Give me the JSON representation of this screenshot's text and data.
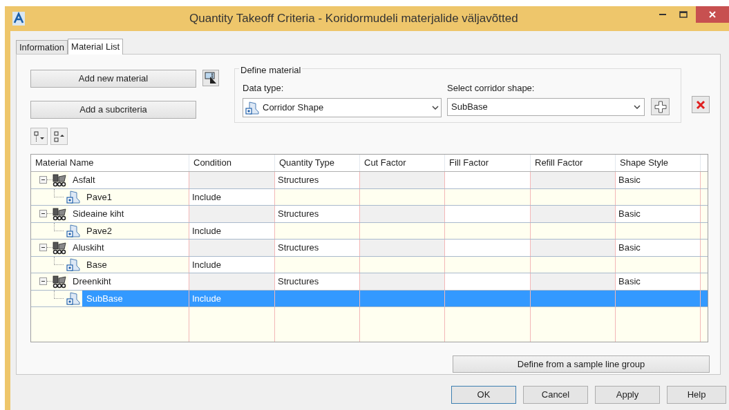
{
  "window": {
    "title": "Quantity Takeoff Criteria - Koridormudeli materjalide väljavõtted"
  },
  "tabs": [
    {
      "label": "Information",
      "selected": false
    },
    {
      "label": "Material List",
      "selected": true
    }
  ],
  "actions": [
    "Add new material",
    "Add a subcriteria"
  ],
  "define_material": {
    "title": "Define material",
    "data_type_label": "Data type:",
    "data_type": "Corridor Shape",
    "shape_label": "Select corridor shape:",
    "shape": "SubBase"
  },
  "table": {
    "columns": [
      "Material Name",
      "Condition",
      "Quantity Type",
      "Cut Factor",
      "Fill Factor",
      "Refill Factor",
      "Shape Style"
    ],
    "rows": [
      {
        "name": "Asfalt",
        "quantity_type": "Structures",
        "shape_style": "Basic",
        "expanded": true,
        "selected": false,
        "children": [
          {
            "name": "Pave1",
            "condition": "Include",
            "selected": false
          }
        ]
      },
      {
        "name": "Sideaine kiht",
        "quantity_type": "Structures",
        "shape_style": "Basic",
        "expanded": true,
        "selected": false,
        "children": [
          {
            "name": "Pave2",
            "condition": "Include",
            "selected": false
          }
        ]
      },
      {
        "name": "Aluskiht",
        "quantity_type": "Structures",
        "shape_style": "Basic",
        "expanded": true,
        "selected": false,
        "children": [
          {
            "name": "Base",
            "condition": "Include",
            "selected": false
          }
        ]
      },
      {
        "name": "Dreenkiht",
        "quantity_type": "Structures",
        "shape_style": "Basic",
        "expanded": true,
        "selected": false,
        "children": [
          {
            "name": "SubBase",
            "condition": "Include",
            "selected": true
          }
        ]
      }
    ]
  },
  "sample_button": "Define from a sample line group",
  "buttons": [
    {
      "label": "OK",
      "default": true
    },
    {
      "label": "Cancel",
      "default": false
    },
    {
      "label": "Apply",
      "default": false
    },
    {
      "label": "Help",
      "default": false
    }
  ]
}
